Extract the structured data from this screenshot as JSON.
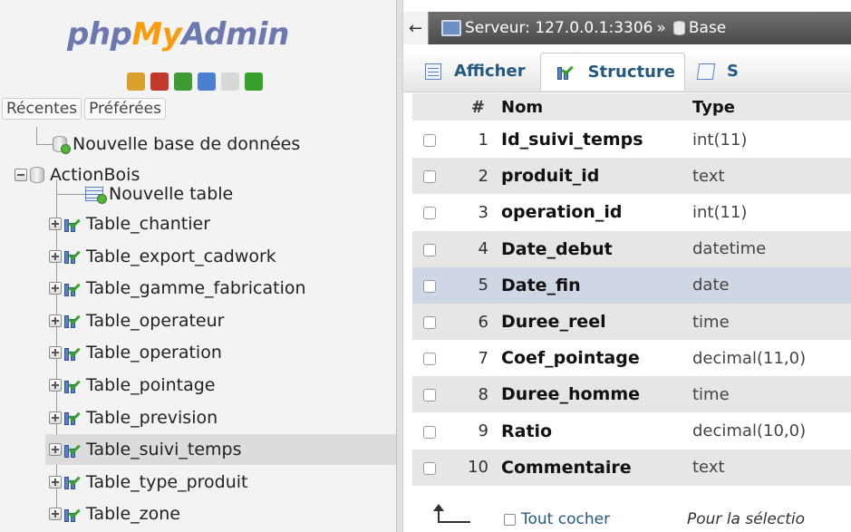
{
  "nav": {
    "logo": {
      "part1": "php",
      "part2": "My",
      "part3": "Admin"
    },
    "quick_icons": [
      {
        "name": "home-icon",
        "color": "#d9a12b"
      },
      {
        "name": "exit-icon",
        "color": "#c0392b"
      },
      {
        "name": "query-window-icon",
        "color": "#3f9c35"
      },
      {
        "name": "help-icon",
        "color": "#4a7fd0"
      },
      {
        "name": "documentation-icon",
        "color": "#d8d8d8"
      },
      {
        "name": "reload-icon",
        "color": "#3aa02d"
      }
    ],
    "tabs": [
      {
        "label": "Récentes"
      },
      {
        "label": "Préférées"
      }
    ],
    "new_database": "Nouvelle base de données",
    "database": {
      "name": "ActionBois",
      "new_table": "Nouvelle table",
      "tables": [
        {
          "label": "Table_chantier"
        },
        {
          "label": "Table_export_cadwork"
        },
        {
          "label": "Table_gamme_fabrication"
        },
        {
          "label": "Table_operateur"
        },
        {
          "label": "Table_operation"
        },
        {
          "label": "Table_pointage"
        },
        {
          "label": "Table_prevision"
        },
        {
          "label": "Table_suivi_temps",
          "active": true
        },
        {
          "label": "Table_type_produit"
        },
        {
          "label": "Table_zone"
        }
      ]
    }
  },
  "breadcrumb": {
    "collapse": "←",
    "server": "Serveur: 127.0.0.1:3306",
    "separator": "»",
    "db": "Base"
  },
  "tabs": [
    {
      "label": "Afficher",
      "icon": "browse-icon"
    },
    {
      "label": "Structure",
      "icon": "structure-icon",
      "active": true
    },
    {
      "label": "S",
      "icon": "sql-icon"
    }
  ],
  "table": {
    "headers": {
      "num": "#",
      "name": "Nom",
      "type": "Type"
    },
    "rows": [
      {
        "num": "1",
        "name": "Id_suivi_temps",
        "type": "int(11)"
      },
      {
        "num": "2",
        "name": "produit_id",
        "type": "text"
      },
      {
        "num": "3",
        "name": "operation_id",
        "type": "int(11)"
      },
      {
        "num": "4",
        "name": "Date_debut",
        "type": "datetime"
      },
      {
        "num": "5",
        "name": "Date_fin",
        "type": "date",
        "highlight": true
      },
      {
        "num": "6",
        "name": "Duree_reel",
        "type": "time"
      },
      {
        "num": "7",
        "name": "Coef_pointage",
        "type": "decimal(11,0)"
      },
      {
        "num": "8",
        "name": "Duree_homme",
        "type": "time"
      },
      {
        "num": "9",
        "name": "Ratio",
        "type": "decimal(10,0)"
      },
      {
        "num": "10",
        "name": "Commentaire",
        "type": "text"
      }
    ]
  },
  "footer": {
    "check_all": "Tout cocher",
    "with_selected": "Pour la sélectio"
  },
  "colors": {
    "accent": "#235a81",
    "logo_blue": "#6c78af",
    "logo_orange": "#f89c0e",
    "row_highlight": "#cfd7e4"
  }
}
